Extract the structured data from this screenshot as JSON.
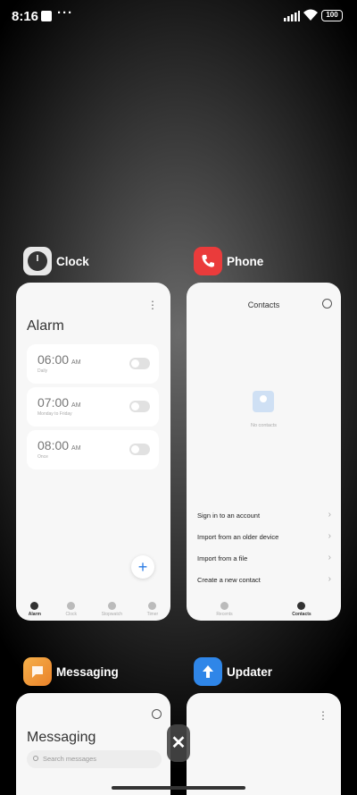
{
  "status_bar": {
    "time": "8:16",
    "dots": "···",
    "battery": "100"
  },
  "cards": {
    "clock": {
      "app_name": "Clock",
      "title": "Alarm",
      "menu": "⋮",
      "alarms": [
        {
          "time": "06:00",
          "ampm": "AM",
          "sub": "Daily"
        },
        {
          "time": "07:00",
          "ampm": "AM",
          "sub": "Monday to Friday"
        },
        {
          "time": "08:00",
          "ampm": "AM",
          "sub": "Once"
        }
      ],
      "fab": "+",
      "nav": [
        "Alarm",
        "Clock",
        "Stopwatch",
        "Timer"
      ]
    },
    "phone": {
      "app_name": "Phone",
      "title": "Contacts",
      "empty": "No contacts",
      "actions": [
        "Sign in to an account",
        "Import from an older device",
        "Import from a file",
        "Create a new contact"
      ],
      "chevron": "›",
      "nav": [
        "Recents",
        "Contacts"
      ]
    },
    "messaging": {
      "app_name": "Messaging",
      "title": "Messaging",
      "search_placeholder": "Search messages"
    },
    "updater": {
      "app_name": "Updater",
      "menu": "⋮"
    }
  },
  "close_label": "✕"
}
